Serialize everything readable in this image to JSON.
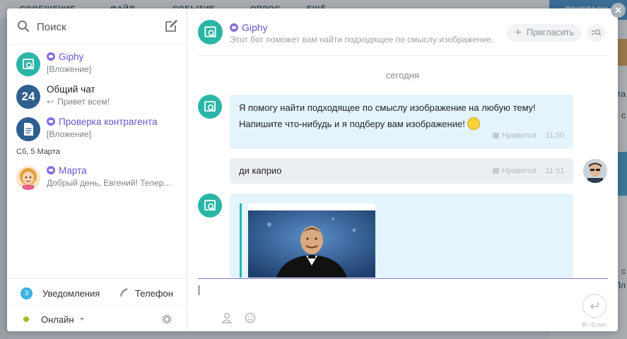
{
  "background": {
    "tabs": [
      "СООБЩЕНИЕ",
      "ФАЙЛ",
      "СОБЫТИЕ",
      "ОПРОС",
      "ЕЩЁ"
    ],
    "invite_label": "ПРИГЛАСИ",
    "snippets": [
      "та",
      "с",
      "с",
      "Пл"
    ]
  },
  "sidebar": {
    "search_label": "Поиск",
    "chats": [
      {
        "name": "Giphy",
        "subtitle": "[Вложение]",
        "is_bot": true
      },
      {
        "name": "Общий чат",
        "subtitle": "Привет всем!",
        "avatar_text": "24",
        "is_bot": false
      },
      {
        "name": "Проверка контрагента",
        "subtitle": "[Вложение]",
        "is_bot": true
      },
      {
        "name": "Марта",
        "subtitle": "Добрый день, Евгений! Тепер...",
        "is_bot": true
      }
    ],
    "date_separator": "Сб, 5 Марта",
    "footer": {
      "notifications_count": "3",
      "notifications_label": "Уведомления",
      "phone_label": "Телефон",
      "status_label": "Онлайн"
    }
  },
  "chat": {
    "header": {
      "name": "Giphy",
      "description": "Этот бот поможет вам найти подходящее по смыслу изображение.",
      "invite_label": "Пригласить"
    },
    "day_label": "сегодня",
    "messages": [
      {
        "line1": "Я помогу найти подходящее по смыслу изображение на любую тему!",
        "line2": "Напишите что-нибудь и я подберу вам изображение!",
        "like_label": "Нравится",
        "time": "11:50"
      },
      {
        "text": "ди каприо",
        "like_label": "Нравится",
        "time": "11:51"
      }
    ],
    "send_hint": "⌘+Enter"
  },
  "colors": {
    "accent_bot": "#6a55c9",
    "giphy_teal": "#2bb5a7",
    "bubble_bot": "#e4f4fd",
    "bubble_me": "#eceff1",
    "online": "#9ac32b"
  }
}
